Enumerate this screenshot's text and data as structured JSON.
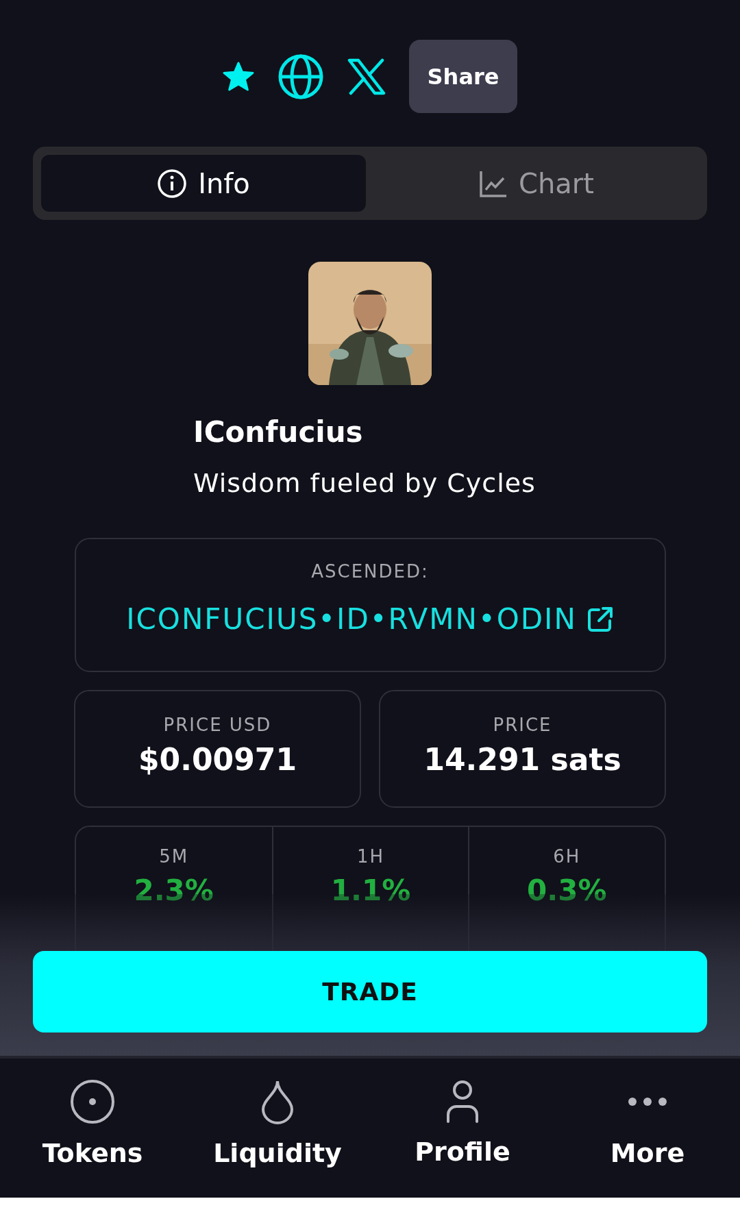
{
  "actions": {
    "favorite": {
      "on": true
    },
    "share_label": "Share"
  },
  "tabs": [
    {
      "label": "Info",
      "selected": true
    },
    {
      "label": "Chart",
      "selected": false
    }
  ],
  "token": {
    "name": "IConfucius",
    "tagline": "Wisdom fueled by Cycles"
  },
  "ascended": {
    "label": "ASCENDED:",
    "link": "ICONFUCIUS•ID•RVMN•ODIN"
  },
  "prices": [
    {
      "label": "PRICE USD",
      "value": "$0.00971"
    },
    {
      "label": "PRICE",
      "value": "14.291 sats"
    }
  ],
  "changes": [
    {
      "period": "5M",
      "value": "2.3%"
    },
    {
      "period": "1H",
      "value": "1.1%"
    },
    {
      "period": "6H",
      "value": "0.3%"
    }
  ],
  "trade_button": "TRADE",
  "nav": [
    {
      "label": "Tokens"
    },
    {
      "label": "Liquidity"
    },
    {
      "label": "Profile"
    },
    {
      "label": "More"
    }
  ]
}
